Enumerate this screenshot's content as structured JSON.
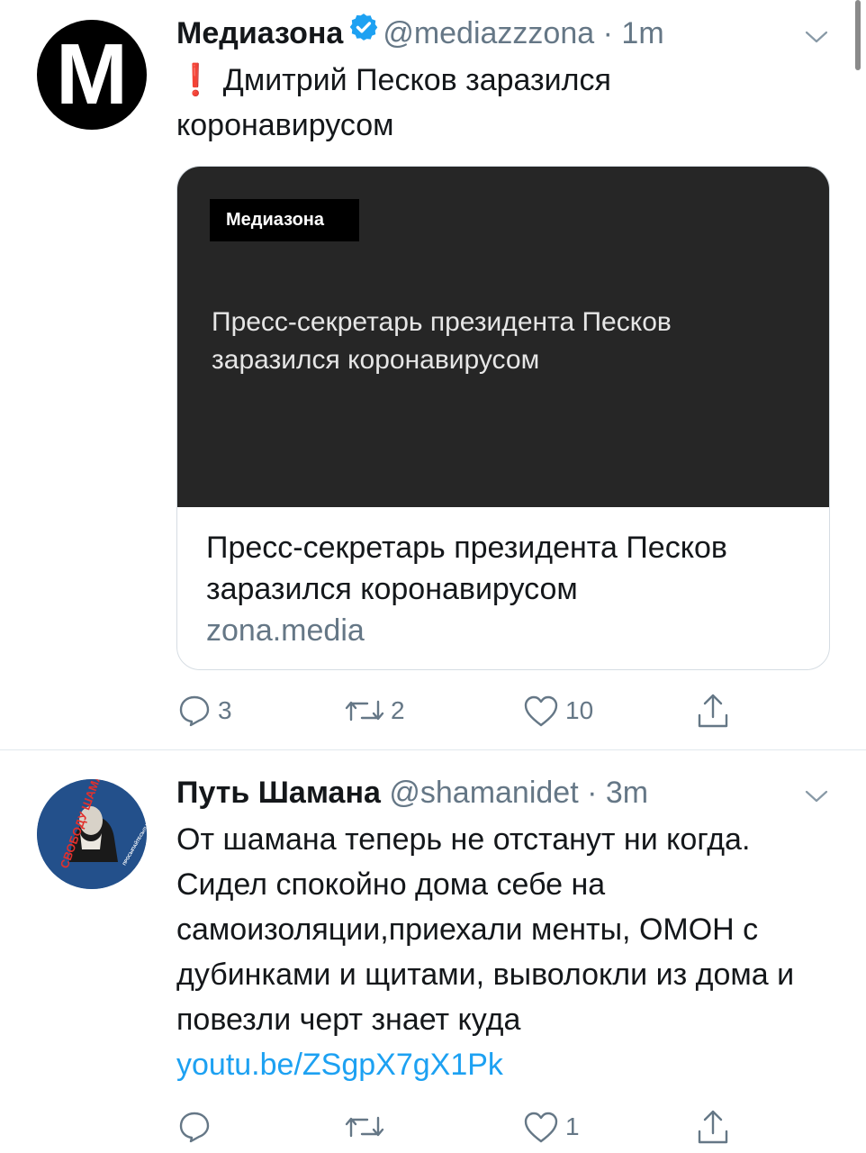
{
  "tweets": [
    {
      "display_name": "Медиазона",
      "handle": "@mediazzzona",
      "separator": "·",
      "time": "1m",
      "text_lines": [
        "❗ Дмитрий Песков заразился",
        "коронавирусом"
      ],
      "avatar_letter": "М",
      "verified": true,
      "card": {
        "brand_label": "Медиазона",
        "image_title": "Пресс-секретарь президента Песков заразился коронавирусом",
        "title": "Пресс-секретарь президента Песков заразился коронавирусом",
        "domain": "zona.media"
      },
      "actions": {
        "replies": "3",
        "retweets": "2",
        "likes": "10"
      }
    },
    {
      "display_name": "Путь Шамана",
      "handle": "@shamanidet",
      "separator": "·",
      "time": "3m",
      "text": "От шамана теперь не отстанут ни когда. Сидел спокойно дома себе на самоизоляции,приехали менты, ОМОН с дубинками и щитами, выволокли из дома и повезли черт знает куда",
      "link": "youtu.be/ZSgpX7gX1Pk",
      "avatar_text": "СВОБОДУ ШАМАНУ",
      "avatar_subtext": "ПРОСЫПАЙТЕСЬ!!! ХВАТИТ МОЛЧАТЬ!!!",
      "actions": {
        "replies": "",
        "retweets": "",
        "likes": "1"
      }
    }
  ],
  "colors": {
    "link": "#1da1f2",
    "secondary": "#657786",
    "verified": "#1da1f2",
    "card_image_bg": "#262626"
  },
  "icons": [
    "verified-badge-icon",
    "chevron-down-icon",
    "reply-icon",
    "retweet-icon",
    "like-icon",
    "share-icon"
  ]
}
